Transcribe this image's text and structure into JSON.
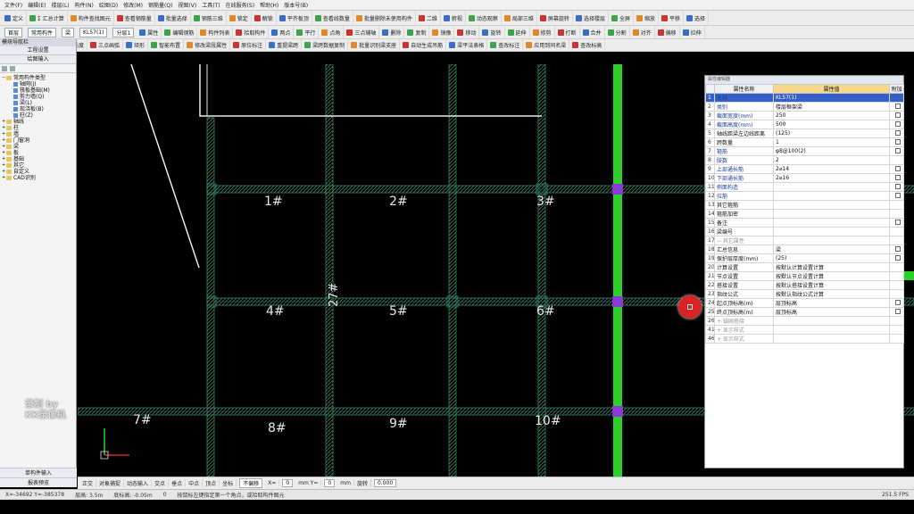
{
  "menu": [
    "文件(F)",
    "编辑(E)",
    "楼层(L)",
    "构件(N)",
    "绘图(D)",
    "修改(M)",
    "钢筋量(Q)",
    "视图(V)",
    "工具(T)",
    "在线服务(S)",
    "帮助(H)",
    "版本号(B)"
  ],
  "toolbar1": [
    "定义",
    "Σ 汇总计算",
    "构件查找图元",
    "查看钢筋量",
    "批量选择",
    "钢筋三维",
    "锁定",
    "解锁",
    "平齐板顶",
    "查看线数量",
    "批量删除未使用构件",
    "二维",
    "俯视",
    "动态观察",
    "局部三维",
    "屏幕旋转",
    "选择楼层",
    "全屏",
    "缩放",
    "平移",
    "选择"
  ],
  "toolbar2": {
    "floor": "首层",
    "category": "常用构件",
    "type": "梁",
    "name": "KL57(1)",
    "layer": "分层1",
    "buttons": [
      "属性",
      "编辑钢筋",
      "构件列表",
      "拾取构件",
      "两点",
      "平行",
      "点角",
      "三点辅轴",
      "删除",
      "复制",
      "镜像",
      "移动",
      "旋转",
      "延伸",
      "修剪",
      "打断",
      "合并",
      "分割",
      "对齐",
      "偏移",
      "拉伸"
    ]
  },
  "toolbar3": [
    "选择",
    "直线",
    "点加长度",
    "三点画弧",
    "矩形",
    "智能布置",
    "修改梁段属性",
    "原位标注",
    "重提梁跨",
    "梁跨数据复制",
    "批量识别梁支座",
    "自动生成吊筋",
    "梁平法表格",
    "查改标注",
    "应用到同名梁",
    "查改标高"
  ],
  "leftpanel": {
    "title": "模块导航栏",
    "tabs": [
      "工程设置",
      "绘图输入"
    ],
    "tree": [
      {
        "pm": "−",
        "label": "常用构件类型",
        "kind": "folder",
        "indent": 0
      },
      {
        "pm": "",
        "label": "轴网(J)",
        "kind": "leaf",
        "indent": 1
      },
      {
        "pm": "",
        "label": "筏板基础(M)",
        "kind": "leaf",
        "indent": 1
      },
      {
        "pm": "",
        "label": "剪力墙(Q)",
        "kind": "leaf",
        "indent": 1
      },
      {
        "pm": "",
        "label": "梁(L)",
        "kind": "leaf",
        "indent": 1
      },
      {
        "pm": "",
        "label": "现浇板(B)",
        "kind": "leaf",
        "indent": 1
      },
      {
        "pm": "",
        "label": "柱(Z)",
        "kind": "leaf",
        "indent": 1
      },
      {
        "pm": "+",
        "label": "轴线",
        "kind": "folder",
        "indent": 0
      },
      {
        "pm": "+",
        "label": "柱",
        "kind": "folder",
        "indent": 0
      },
      {
        "pm": "+",
        "label": "墙",
        "kind": "folder",
        "indent": 0
      },
      {
        "pm": "+",
        "label": "门窗洞",
        "kind": "folder",
        "indent": 0
      },
      {
        "pm": "+",
        "label": "梁",
        "kind": "folder",
        "indent": 0
      },
      {
        "pm": "+",
        "label": "板",
        "kind": "folder",
        "indent": 0
      },
      {
        "pm": "+",
        "label": "基础",
        "kind": "folder",
        "indent": 0
      },
      {
        "pm": "+",
        "label": "其它",
        "kind": "folder",
        "indent": 0
      },
      {
        "pm": "+",
        "label": "自定义",
        "kind": "folder",
        "indent": 0
      },
      {
        "pm": "+",
        "label": "CAD识别",
        "kind": "folder",
        "indent": 0
      }
    ],
    "bottom_tabs": [
      "单构件输入",
      "报表预览"
    ]
  },
  "canvas": {
    "grid_labels": [
      "1#",
      "2#",
      "3#",
      "4#",
      "5#",
      "6#",
      "7#",
      "8#",
      "9#",
      "10#"
    ],
    "beam_label": "27#",
    "watermark_line1": "录制 by",
    "watermark_line2": "KK录像机"
  },
  "props": {
    "title": "属性编辑器",
    "headers": [
      "属性名称",
      "属性值",
      "附加"
    ],
    "rows": [
      {
        "n": "1",
        "name": "名称",
        "value": "KL57(1)",
        "chk": false,
        "cls": "blue",
        "sel": true
      },
      {
        "n": "2",
        "name": "类别",
        "value": "楼层框架梁",
        "chk": true,
        "cls": "blue"
      },
      {
        "n": "3",
        "name": "截面宽度(mm)",
        "value": "250",
        "chk": true,
        "cls": "blue"
      },
      {
        "n": "4",
        "name": "截面高度(mm)",
        "value": "500",
        "chk": true,
        "cls": "blue"
      },
      {
        "n": "5",
        "name": "轴线距梁左边线距离",
        "value": "(125)",
        "chk": true,
        "cls": ""
      },
      {
        "n": "6",
        "name": "跨数量",
        "value": "1",
        "chk": true,
        "cls": ""
      },
      {
        "n": "7",
        "name": "箍筋",
        "value": "φ8@100(2)",
        "chk": true,
        "cls": "blue"
      },
      {
        "n": "8",
        "name": "肢数",
        "value": "2",
        "chk": false,
        "cls": "blue"
      },
      {
        "n": "9",
        "name": "上部通长筋",
        "value": "2⌀14",
        "chk": true,
        "cls": "blue"
      },
      {
        "n": "10",
        "name": "下部通长筋",
        "value": "2⌀16",
        "chk": true,
        "cls": "blue"
      },
      {
        "n": "11",
        "name": "侧面构造",
        "value": "",
        "chk": true,
        "cls": "blue"
      },
      {
        "n": "12",
        "name": "拉筋",
        "value": "",
        "chk": true,
        "cls": "blue"
      },
      {
        "n": "13",
        "name": "其它箍筋",
        "value": "",
        "chk": false,
        "cls": ""
      },
      {
        "n": "14",
        "name": "箍筋加密",
        "value": "",
        "chk": false,
        "cls": ""
      },
      {
        "n": "15",
        "name": "备注",
        "value": "",
        "chk": true,
        "cls": ""
      },
      {
        "n": "16",
        "name": "梁编号",
        "value": "",
        "chk": false,
        "cls": ""
      },
      {
        "n": "17",
        "name": "− 其它属性",
        "value": "",
        "chk": false,
        "cls": "grey"
      },
      {
        "n": "18",
        "name": "汇总信息",
        "value": "梁",
        "chk": true,
        "cls": ""
      },
      {
        "n": "19",
        "name": "保护层厚度(mm)",
        "value": "(25)",
        "chk": true,
        "cls": ""
      },
      {
        "n": "20",
        "name": "计算设置",
        "value": "按默认计算设置计算",
        "chk": false,
        "cls": ""
      },
      {
        "n": "21",
        "name": "节点设置",
        "value": "按默认节点设置计算",
        "chk": false,
        "cls": ""
      },
      {
        "n": "22",
        "name": "搭接设置",
        "value": "按默认搭接设置计算",
        "chk": false,
        "cls": ""
      },
      {
        "n": "23",
        "name": "指纹公式",
        "value": "按默认指纹公式计算",
        "chk": false,
        "cls": ""
      },
      {
        "n": "24",
        "name": "起点顶标高(m)",
        "value": "层顶标高",
        "chk": true,
        "cls": ""
      },
      {
        "n": "25",
        "name": "终点顶标高(m)",
        "value": "层顶标高",
        "chk": true,
        "cls": ""
      },
      {
        "n": "26",
        "name": "+ 锚固搭接",
        "value": "",
        "chk": false,
        "cls": "grey"
      },
      {
        "n": "41",
        "name": "+ 显示样式",
        "value": "",
        "chk": false,
        "cls": "grey"
      },
      {
        "n": "46",
        "name": "+ 显示样式",
        "value": "",
        "chk": false,
        "cls": "grey"
      }
    ]
  },
  "bottombar": [
    "正交",
    "对象捕捉",
    "动态输入",
    "交点",
    "垂点",
    "中点",
    "顶点",
    "坐标",
    "不偏移",
    "X=",
    "0",
    "mm Y=",
    "0",
    "mm",
    "旋转",
    "0.000"
  ],
  "statusbar": {
    "coords": "X=-34692  Y=-385378",
    "floor_h": "层高: 3.5m",
    "base_h": "底标高: -0.05m",
    "val": "0",
    "hint": "按鼠标左键指定第一个角点，或拾取构件图元",
    "right": "251.5 FPS"
  },
  "colors": {
    "axis_green": "#2bd02b",
    "beam_hatch": "#3a6f3a",
    "column_purple": "#8a3ad0",
    "selection_blue": "#3560c8",
    "float_button": "#d92222"
  }
}
